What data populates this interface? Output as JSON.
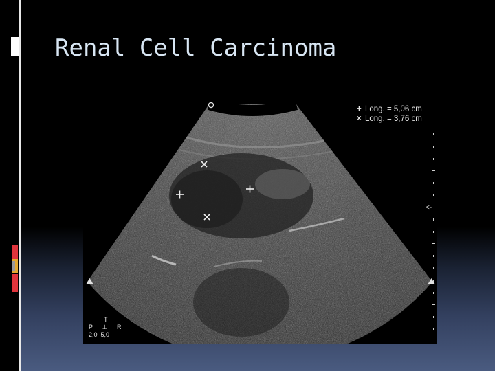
{
  "slide": {
    "title": "Renal Cell Carcinoma"
  },
  "ultrasound": {
    "measurements": [
      {
        "symbol": "+",
        "text": "Long. = 5,06 cm"
      },
      {
        "symbol": "×",
        "text": "Long. = 3,76 cm"
      }
    ],
    "orientation": {
      "top": "T",
      "left": "P",
      "right": "R",
      "values": "2,0  5,0"
    },
    "depth_marker": "<-"
  },
  "colors": {
    "title_text": "#d8e6f3",
    "accent_red": "#e0343c",
    "accent_yellow": "#e3a72f"
  }
}
